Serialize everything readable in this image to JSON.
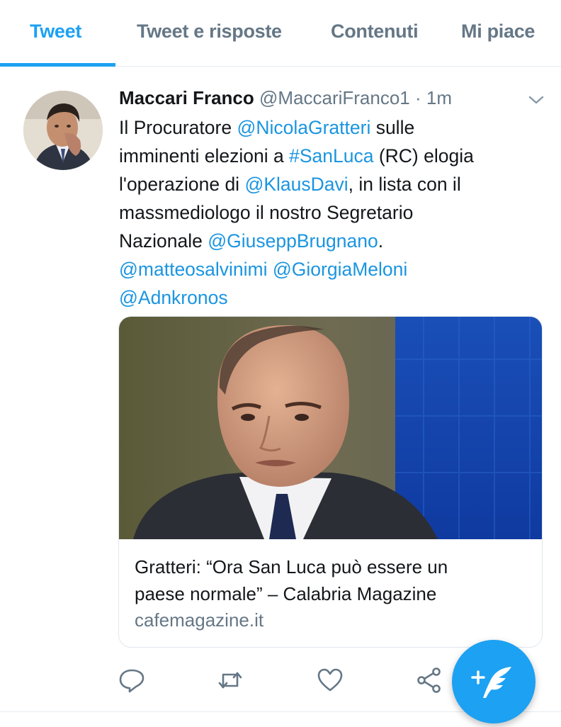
{
  "tabs": [
    {
      "label": "Tweet",
      "active": true
    },
    {
      "label": "Tweet e risposte",
      "active": false
    },
    {
      "label": "Contenuti",
      "active": false
    },
    {
      "label": "Mi piace",
      "active": false
    }
  ],
  "tweet": {
    "author_name": "Maccari Franco",
    "author_handle": "@MaccariFranco1",
    "separator": "·",
    "time": "1m",
    "text_lines": [
      [
        {
          "t": "Il Procuratore "
        },
        {
          "t": "@NicolaGratteri",
          "link": true
        },
        {
          "t": " sulle"
        }
      ],
      [
        {
          "t": "imminenti elezioni a "
        },
        {
          "t": "#SanLuca",
          "link": true
        },
        {
          "t": " (RC) elogia"
        }
      ],
      [
        {
          "t": "l'operazione di "
        },
        {
          "t": "@KlausDavi",
          "link": true
        },
        {
          "t": ", in lista con il"
        }
      ],
      [
        {
          "t": "massmediologo il nostro Segretario"
        }
      ],
      [
        {
          "t": "Nazionale "
        },
        {
          "t": "@GiuseppBrugnano",
          "link": true
        },
        {
          "t": "."
        }
      ],
      [
        {
          "t": "@matteosalvinimi",
          "link": true
        },
        {
          "t": " "
        },
        {
          "t": "@GiorgiaMeloni",
          "link": true
        }
      ],
      [
        {
          "t": "@Adnkronos",
          "link": true
        }
      ]
    ],
    "card": {
      "title_lines": [
        "Gratteri: “Ora San Luca può essere un",
        "paese normale” – Calabria Magazine"
      ],
      "domain": "cafemagazine.it"
    }
  },
  "actions": {
    "icons": [
      "reply-icon",
      "retweet-icon",
      "like-icon",
      "share-icon"
    ]
  },
  "fab": {
    "icon": "compose-tweet-icon"
  },
  "colors": {
    "accent": "#1da1f2",
    "link": "#1b95e0",
    "text": "#14171a",
    "muted": "#657786",
    "border": "#e1e8ed"
  }
}
